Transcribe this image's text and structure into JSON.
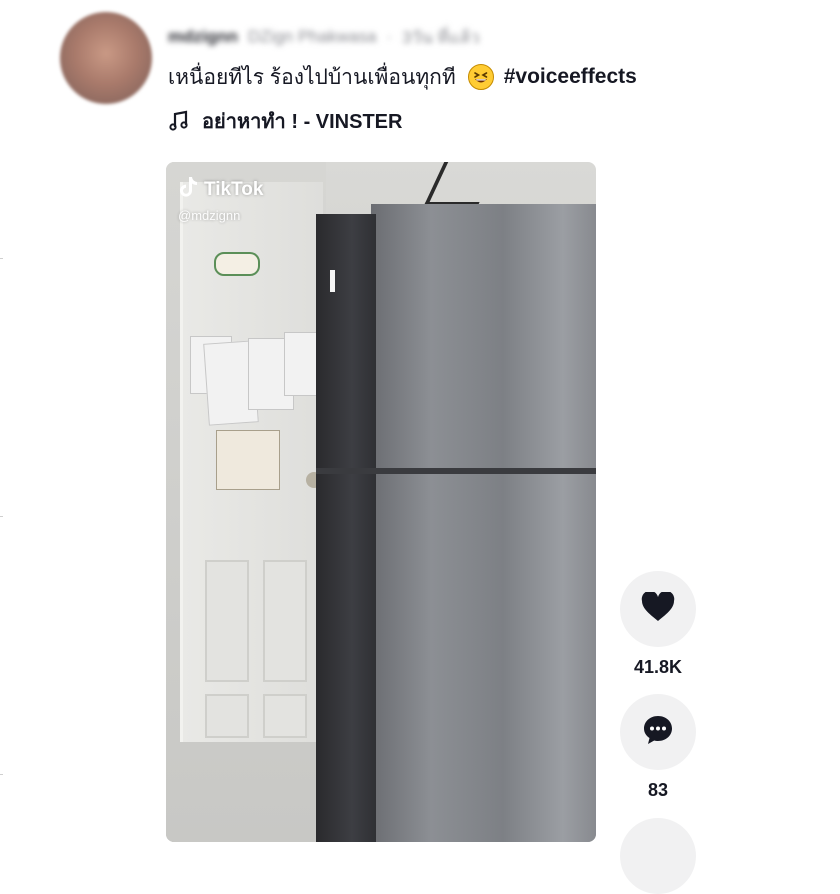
{
  "post": {
    "author_line": {
      "username": "mdzignn",
      "display_name": "DZign Phakwasa",
      "date": "3วัน ที่แล้ว"
    },
    "caption": {
      "text": "เหนื่อยทีไร ร้องไปบ้านเพื่อนทุกที",
      "emoji": "grinning-squinting-face",
      "hashtag": "#voiceeffects"
    },
    "music": {
      "icon": "music-note-icon",
      "title": "อย่าหาทำ ! - VINSTER"
    }
  },
  "video": {
    "watermark_brand": "TikTok",
    "watermark_user": "@mdzignn"
  },
  "actions": {
    "like": {
      "icon": "heart-icon",
      "count": "41.8K"
    },
    "comment": {
      "icon": "comment-icon",
      "count": "83"
    }
  },
  "colors": {
    "text": "#161823",
    "action_bg": "#f1f1f2"
  }
}
